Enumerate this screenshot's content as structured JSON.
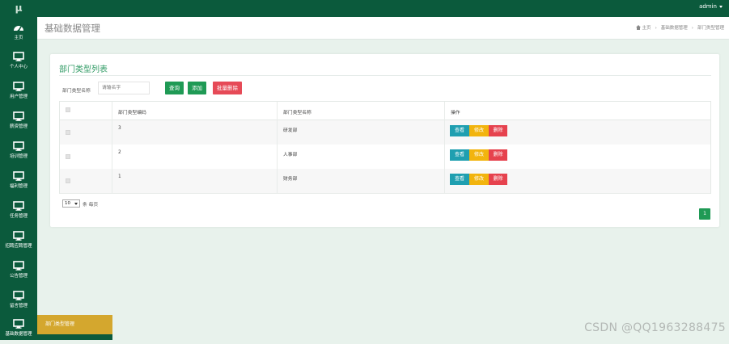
{
  "app": {
    "logo": "μ",
    "user": "admin"
  },
  "sidebar": {
    "items": [
      {
        "label": "主页",
        "icon": "dashboard-icon"
      },
      {
        "label": "个人中心",
        "icon": "monitor-icon"
      },
      {
        "label": "用户管理",
        "icon": "monitor-icon"
      },
      {
        "label": "薪资管理",
        "icon": "monitor-icon"
      },
      {
        "label": "培训管理",
        "icon": "monitor-icon"
      },
      {
        "label": "福利管理",
        "icon": "monitor-icon"
      },
      {
        "label": "任务管理",
        "icon": "monitor-icon"
      },
      {
        "label": "招聘应聘管理",
        "icon": "monitor-icon"
      },
      {
        "label": "公告管理",
        "icon": "monitor-icon"
      },
      {
        "label": "留言管理",
        "icon": "monitor-icon"
      },
      {
        "label": "基础数据管理",
        "icon": "monitor-icon"
      }
    ],
    "submenu_active": "部门类型管理"
  },
  "header": {
    "title": "基础数据管理",
    "breadcrumb": [
      "主页",
      "基础数据管理",
      "部门类型管理"
    ]
  },
  "panel": {
    "title": "部门类型列表",
    "search": {
      "label": "部门类型名称",
      "placeholder": "请输名字",
      "value": ""
    },
    "buttons": {
      "query": "查询",
      "add": "添加",
      "batch_delete": "批量删除"
    },
    "table": {
      "columns": [
        "部门类型编码",
        "部门类型名称",
        "操作"
      ],
      "rows": [
        {
          "code": "3",
          "name": "研发部"
        },
        {
          "code": "2",
          "name": "人事部"
        },
        {
          "code": "1",
          "name": "财务部"
        }
      ],
      "actions": {
        "view": "查看",
        "edit": "修改",
        "delete": "删除"
      }
    },
    "pagination": {
      "page_size": "10",
      "per_page_label": "条 每页",
      "current_page": "1"
    }
  },
  "watermark": "CSDN @QQ1963288475",
  "colors": {
    "primary_dark": "#0b5a3c",
    "accent_green": "#1f9a55",
    "danger": "#e64a57",
    "info": "#1f9fb0",
    "warning": "#f2b40e",
    "submenu": "#d4a72e"
  }
}
